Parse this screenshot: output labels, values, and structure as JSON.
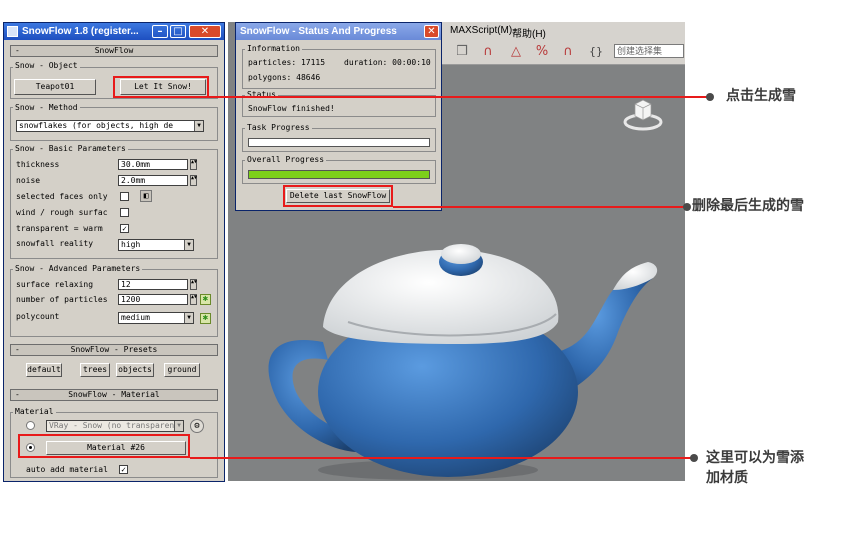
{
  "max": {
    "menu": {
      "maxscript": "MAXScript(M)",
      "help": "帮助(H)"
    },
    "toolbar": {
      "selection_set_placeholder": "创建选择集"
    }
  },
  "snowflow": {
    "title": "SnowFlow 1.8 (register...",
    "rollout_main": "SnowFlow",
    "object_group": "Snow - Object",
    "object_button": "Teapot01",
    "let_it_snow": "Let It Snow!",
    "method_group": "Snow - Method",
    "method_value": "snowflakes   (for objects, high de",
    "basic_group": "Snow - Basic Parameters",
    "thickness_label": "thickness",
    "thickness_value": "30.0mm",
    "noise_label": "noise",
    "noise_value": "2.0mm",
    "selected_faces_label": "selected faces only",
    "wind_label": "wind / rough surfac",
    "transparent_label": "transparent = warm",
    "transparent_checked": "✓",
    "reality_label": "snowfall reality",
    "reality_value": "high",
    "advanced_group": "Snow - Advanced Parameters",
    "relaxing_label": "surface relaxing",
    "relaxing_value": "12",
    "particles_label": "number of particles",
    "particles_value": "1200",
    "polycount_label": "polycount",
    "polycount_value": "medium",
    "presets_rollout": "SnowFlow - Presets",
    "presets": [
      "default",
      "trees",
      "objects",
      "ground"
    ],
    "material_rollout": "SnowFlow - Material",
    "material_group": "Material",
    "material_dropdown": "VRay - Snow (no transparen",
    "material_button": "Material #26",
    "auto_add_label": "auto add material",
    "auto_add_checked": "✓"
  },
  "status": {
    "title": "SnowFlow - Status And Progress",
    "info_group": "Information",
    "particles": "particles: 17115",
    "duration": "duration: 00:00:10",
    "polygons": "polygons: 48646",
    "status_group": "Status",
    "status_text": "SnowFlow finished!",
    "task_group": "Task Progress",
    "task_progress": 0.0,
    "overall_group": "Overall Progress",
    "overall_progress": 1.0,
    "delete_button": "Delete last SnowFlow"
  },
  "annotations": {
    "click_snow": "点击生成雪",
    "delete_last": "删除最后生成的雪",
    "add_material_line1": "这里可以为雪添",
    "add_material_line2": "加材质"
  },
  "colors": {
    "annotation_red": "#e81a1a",
    "progress_green": "#7dd01a",
    "teapot_blue": "#3a73b8",
    "viewport_gray": "#808283"
  }
}
